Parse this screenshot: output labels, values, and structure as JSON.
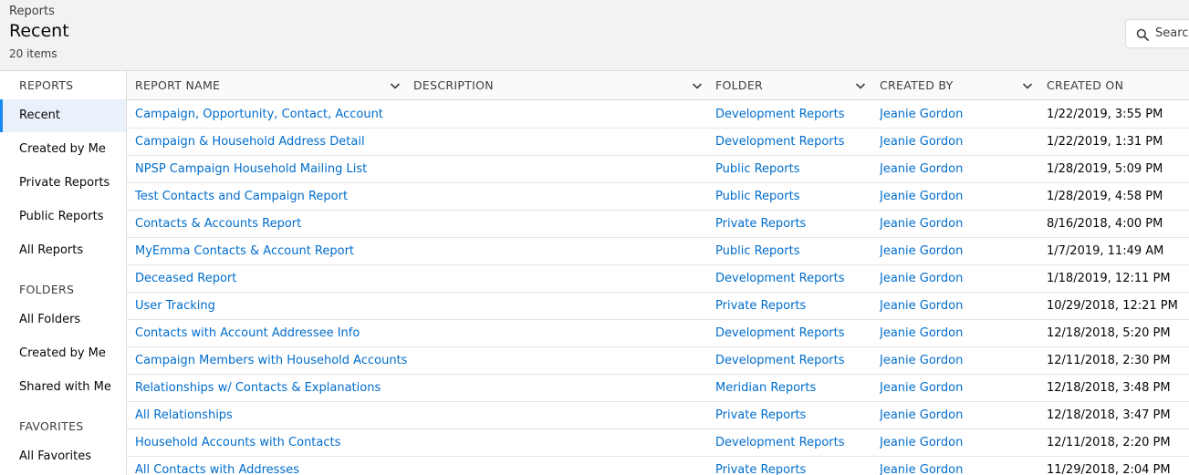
{
  "header": {
    "breadcrumb": "Reports",
    "title": "Recent",
    "item_count": "20 items",
    "search_placeholder": "Search"
  },
  "sidebar": {
    "reports_heading": "REPORTS",
    "reports_items": [
      "Recent",
      "Created by Me",
      "Private Reports",
      "Public Reports",
      "All Reports"
    ],
    "folders_heading": "FOLDERS",
    "folders_items": [
      "All Folders",
      "Created by Me",
      "Shared with Me"
    ],
    "favorites_heading": "FAVORITES",
    "favorites_items": [
      "All Favorites"
    ]
  },
  "table": {
    "columns": [
      "REPORT NAME",
      "DESCRIPTION",
      "FOLDER",
      "CREATED BY",
      "CREATED ON"
    ],
    "rows": [
      {
        "name": "Campaign, Opportunity, Contact, Account",
        "description": "",
        "folder": "Development Reports",
        "created_by": "Jeanie Gordon",
        "created_on": "1/22/2019, 3:55 PM"
      },
      {
        "name": "Campaign & Household Address Detail",
        "description": "",
        "folder": "Development Reports",
        "created_by": "Jeanie Gordon",
        "created_on": "1/22/2019, 1:31 PM"
      },
      {
        "name": "NPSP Campaign Household Mailing List",
        "description": "",
        "folder": "Public Reports",
        "created_by": "Jeanie Gordon",
        "created_on": "1/28/2019, 5:09 PM"
      },
      {
        "name": "Test Contacts and Campaign Report",
        "description": "",
        "folder": "Public Reports",
        "created_by": "Jeanie Gordon",
        "created_on": "1/28/2019, 4:58 PM"
      },
      {
        "name": "Contacts & Accounts Report",
        "description": "",
        "folder": "Private Reports",
        "created_by": "Jeanie Gordon",
        "created_on": "8/16/2018, 4:00 PM"
      },
      {
        "name": "MyEmma Contacts & Account Report",
        "description": "",
        "folder": "Public Reports",
        "created_by": "Jeanie Gordon",
        "created_on": "1/7/2019, 11:49 AM"
      },
      {
        "name": "Deceased Report",
        "description": "",
        "folder": "Development Reports",
        "created_by": "Jeanie Gordon",
        "created_on": "1/18/2019, 12:11 PM"
      },
      {
        "name": "User Tracking",
        "description": "",
        "folder": "Private Reports",
        "created_by": "Jeanie Gordon",
        "created_on": "10/29/2018, 12:21 PM"
      },
      {
        "name": "Contacts with Account Addressee Info",
        "description": "",
        "folder": "Development Reports",
        "created_by": "Jeanie Gordon",
        "created_on": "12/18/2018, 5:20 PM"
      },
      {
        "name": "Campaign Members with Household Accounts",
        "description": "",
        "folder": "Development Reports",
        "created_by": "Jeanie Gordon",
        "created_on": "12/11/2018, 2:30 PM"
      },
      {
        "name": "Relationships w/ Contacts & Explanations",
        "description": "",
        "folder": "Meridian Reports",
        "created_by": "Jeanie Gordon",
        "created_on": "12/18/2018, 3:48 PM"
      },
      {
        "name": "All Relationships",
        "description": "",
        "folder": "Private Reports",
        "created_by": "Jeanie Gordon",
        "created_on": "12/18/2018, 3:47 PM"
      },
      {
        "name": "Household Accounts with Contacts",
        "description": "",
        "folder": "Development Reports",
        "created_by": "Jeanie Gordon",
        "created_on": "12/11/2018, 2:20 PM"
      },
      {
        "name": "All Contacts with Addresses",
        "description": "",
        "folder": "Private Reports",
        "created_by": "Jeanie Gordon",
        "created_on": "11/29/2018, 2:04 PM"
      }
    ]
  },
  "colors": {
    "link": "#006dcc",
    "active_bg": "#eaf1fb",
    "active_border": "#1589ee",
    "header_bg": "#f3f2f2"
  },
  "icons": {
    "search": "search-icon",
    "sort": "chevron-down-icon"
  }
}
